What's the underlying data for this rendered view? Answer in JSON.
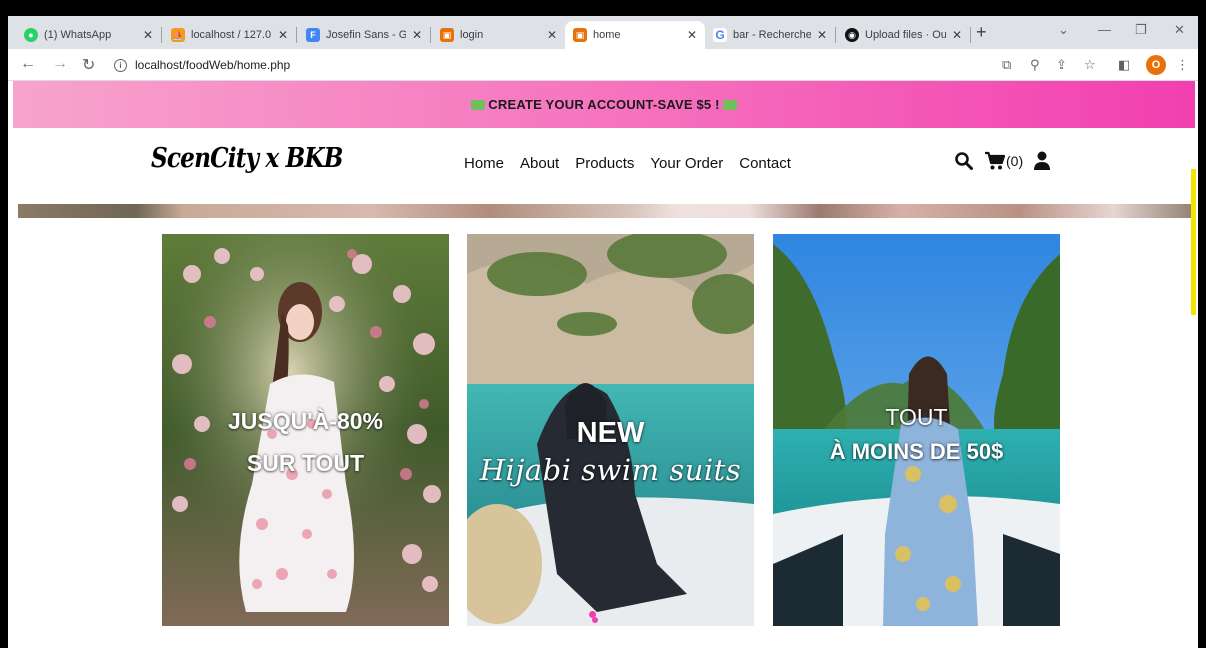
{
  "browser": {
    "tabs": [
      {
        "title": "(1) WhatsApp",
        "icon": "whatsapp-icon",
        "color": "#25d366"
      },
      {
        "title": "localhost / 127.0.",
        "icon": "phpmyadmin-icon",
        "color": "#f29b1d"
      },
      {
        "title": "Josefin Sans - Go",
        "icon": "google-fonts-icon",
        "color": "#4285f4"
      },
      {
        "title": "login",
        "icon": "page-icon",
        "color": "#e8710a"
      },
      {
        "title": "home",
        "icon": "page-icon",
        "color": "#e8710a",
        "active": true
      },
      {
        "title": "bar - Recherche",
        "icon": "google-icon",
        "color": "#4285f4"
      },
      {
        "title": "Upload files · Ou",
        "icon": "github-icon",
        "color": "#111111"
      }
    ],
    "url": "localhost/foodWeb/home.php",
    "profile_initial": "O"
  },
  "promo": {
    "text": "CREATE YOUR ACCOUNT-SAVE $5 !"
  },
  "header": {
    "logo": "ScenCity x BKB",
    "menu": [
      "Home",
      "About",
      "Products",
      "Your Order",
      "Contact"
    ],
    "cart_count": "(0)"
  },
  "cards": [
    {
      "line1": "JUSQU'À-80%",
      "line2": "SUR TOUT"
    },
    {
      "line1": "NEW",
      "line2": "Hijabi swim suits"
    },
    {
      "line1": "TOUT",
      "line2": "À MOINS DE 50$"
    }
  ],
  "colors": {
    "accent": "#f23fb0",
    "scroll_accent": "#f2e600"
  }
}
